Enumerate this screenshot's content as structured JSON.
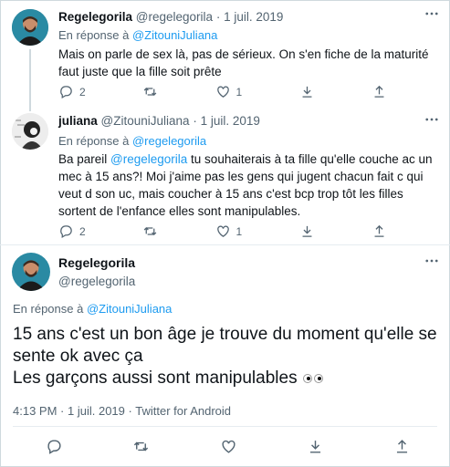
{
  "tweets": [
    {
      "display_name": "Regelegorila",
      "handle": "@regelegorila",
      "sep": "·",
      "date": "1 juil. 2019",
      "reply_prefix": "En réponse à",
      "reply_to": "@ZitouniJuliana",
      "text": "Mais on parle de sex là, pas de sérieux. On s'en fiche de la maturité faut juste que la fille soit prête",
      "reply_count": "2",
      "like_count": "1"
    },
    {
      "display_name": "juliana",
      "handle": "@ZitouniJuliana",
      "sep": "·",
      "date": "1 juil. 2019",
      "reply_prefix": "En réponse à",
      "reply_to": "@regelegorila",
      "text_prefix": "Ba pareil ",
      "text_mention": "@regelegorila",
      "text_rest": " tu souhaiterais à ta fille qu'elle couche ac un mec à 15 ans?! Moi j'aime pas les gens qui jugent chacun fait c qui veut d son uc, mais coucher à 15 ans c'est bcp trop tôt les filles sortent de l'enfance elles sont manipulables.",
      "reply_count": "2",
      "like_count": "1"
    }
  ],
  "main_tweet": {
    "display_name": "Regelegorila",
    "handle": "@regelegorila",
    "reply_prefix": "En réponse à",
    "reply_to": "@ZitouniJuliana",
    "line1": "15 ans c'est un bon âge je trouve du moment qu'elle se sente ok avec ça",
    "line2": "Les garçons aussi sont manipulables",
    "emoji": "eyes",
    "time": "4:13 PM",
    "date": "1 juil. 2019",
    "source": "Twitter for Android",
    "more": "···"
  },
  "icons": [
    "reply-icon",
    "retweet-icon",
    "like-icon",
    "bookmark-icon",
    "share-icon",
    "more-icon"
  ],
  "colors": {
    "accent": "#1d9bf0",
    "muted": "#536471",
    "text": "#0f1419"
  }
}
